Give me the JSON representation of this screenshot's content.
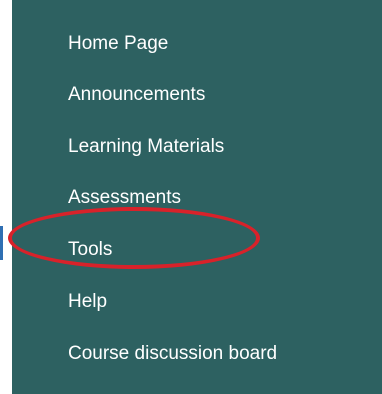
{
  "course_menu": {
    "items": [
      {
        "label": "Home Page"
      },
      {
        "label": "Announcements"
      },
      {
        "label": "Learning Materials"
      },
      {
        "label": "Assessments"
      },
      {
        "label": "Tools"
      },
      {
        "label": "Help"
      },
      {
        "label": "Course discussion board"
      }
    ],
    "highlighted_item": "Tools"
  },
  "colors": {
    "menu_background": "#2d6161",
    "menu_text": "#ffffff",
    "highlight_ring": "#d8222a",
    "left_edge_marker": "#2f6fb3"
  }
}
